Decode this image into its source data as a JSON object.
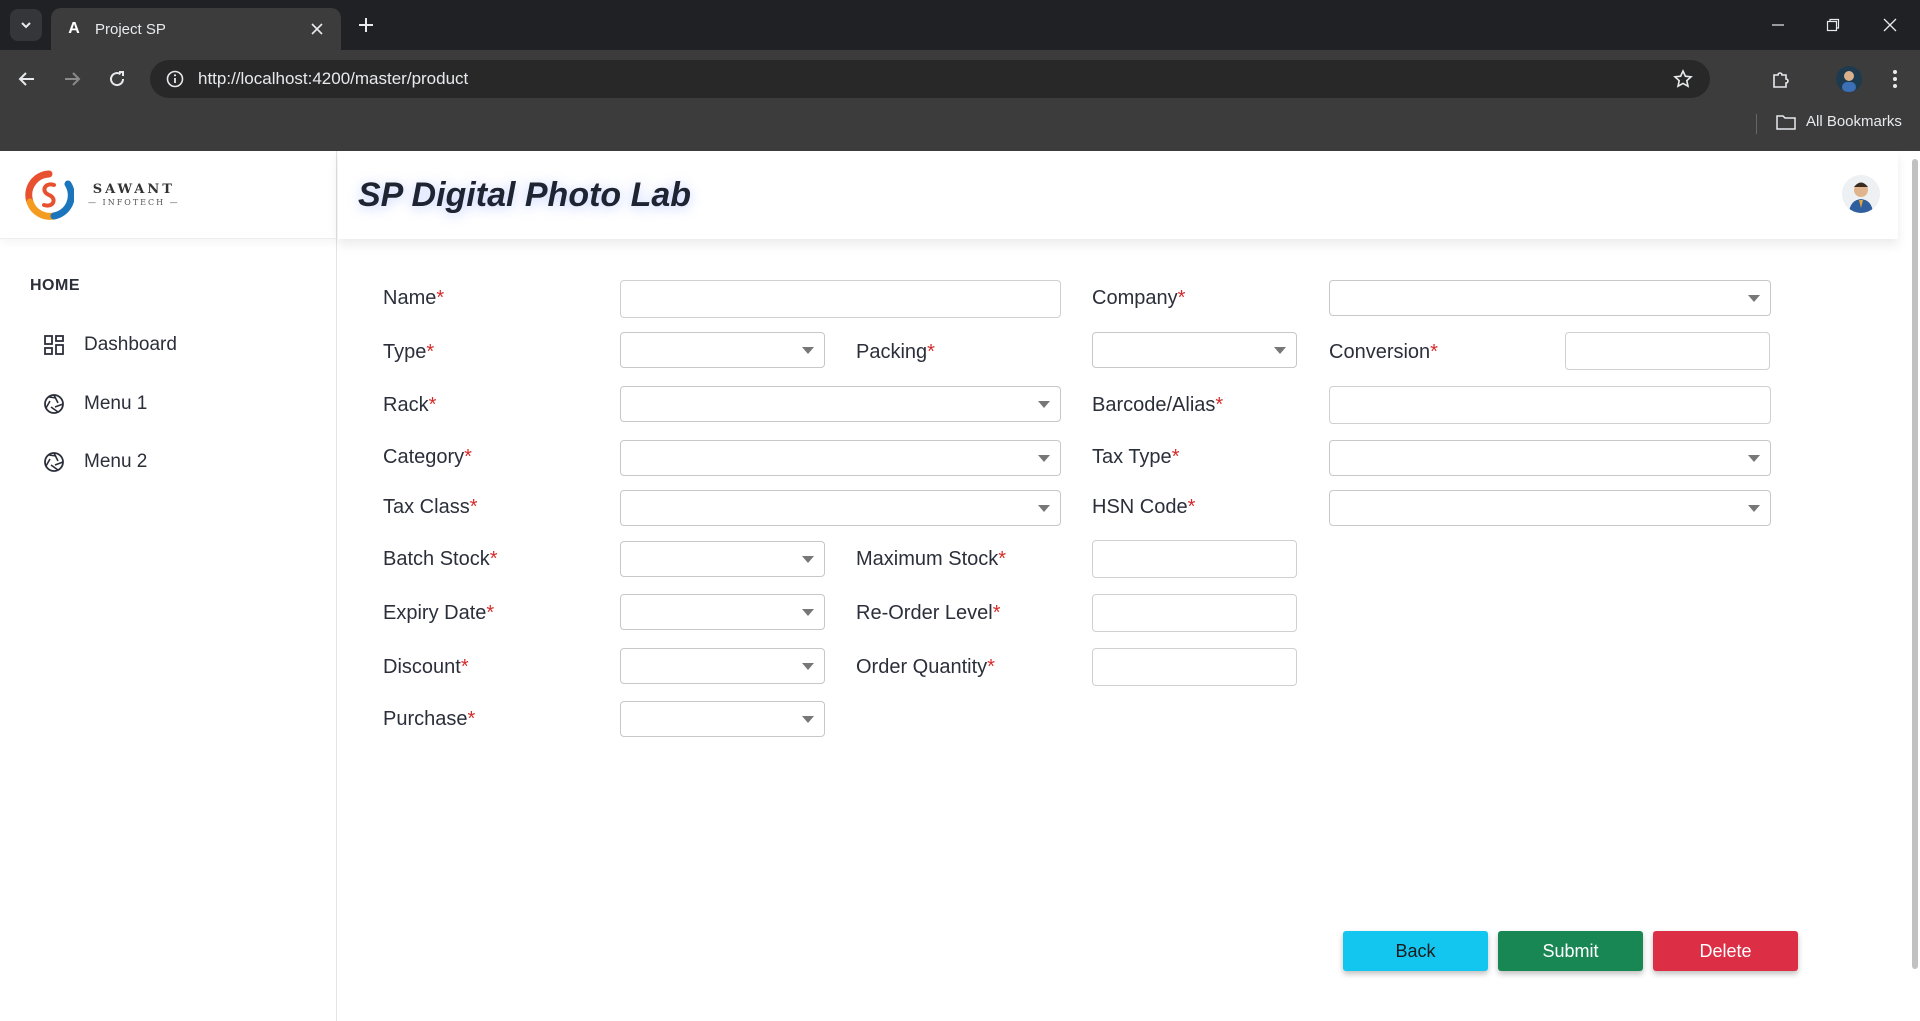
{
  "browser": {
    "tab_title": "Project SP",
    "url": "http://localhost:4200/master/product",
    "bookmarks_label": "All Bookmarks"
  },
  "brand": {
    "name": "SAWANT",
    "sub": "INFOTECH",
    "accent_colors": [
      "#e8512f",
      "#f39c1f",
      "#1b75bc"
    ]
  },
  "sidebar": {
    "section": "HOME",
    "items": [
      {
        "label": "Dashboard",
        "icon": "dashboard-grid-icon"
      },
      {
        "label": "Menu 1",
        "icon": "aperture-icon"
      },
      {
        "label": "Menu 2",
        "icon": "aperture-icon"
      }
    ]
  },
  "header": {
    "title": "SP Digital Photo Lab"
  },
  "form": {
    "required_mark": "*",
    "labels": {
      "name": "Name",
      "company": "Company",
      "type": "Type",
      "packing": "Packing",
      "conversion": "Conversion",
      "rack": "Rack",
      "barcode": "Barcode/Alias",
      "category": "Category",
      "tax_type": "Tax Type",
      "tax_class": "Tax Class",
      "hsn_code": "HSN Code",
      "batch_stock": "Batch Stock",
      "maximum_stock": "Maximum Stock",
      "expiry_date": "Expiry Date",
      "reorder_level": "Re-Order Level",
      "discount": "Discount",
      "order_quantity": "Order Quantity",
      "purchase": "Purchase"
    },
    "values": {
      "name": "",
      "company": "",
      "type": "",
      "packing": "",
      "conversion": "",
      "rack": "",
      "barcode": "",
      "category": "",
      "tax_type": "",
      "tax_class": "",
      "hsn_code": "",
      "batch_stock": "",
      "maximum_stock": "",
      "expiry_date": "",
      "reorder_level": "",
      "discount": "",
      "order_quantity": "",
      "purchase": ""
    }
  },
  "actions": {
    "back": "Back",
    "submit": "Submit",
    "delete": "Delete"
  },
  "colors": {
    "back": "#12c6ef",
    "submit": "#198754",
    "delete": "#dc2f45",
    "required": "#d62b2b"
  }
}
